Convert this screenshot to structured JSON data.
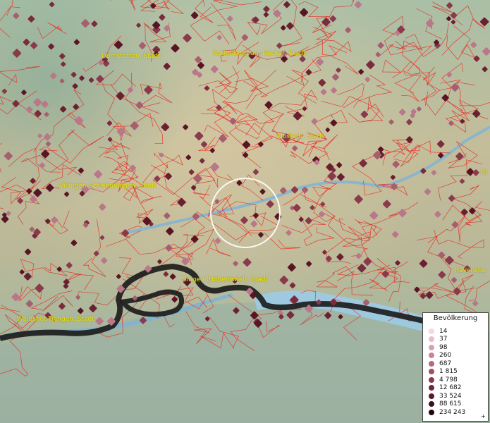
{
  "map": {
    "places": [
      {
        "name": "Dornstetten, Stadt"
      },
      {
        "name": "Rottenburg am Neckar, Stadt"
      },
      {
        "name": "Albstadt, Stadt"
      },
      {
        "name": "Villingen-Schwenningen, Stadt"
      },
      {
        "name": "Singen (Hohentwiel), Stadt"
      },
      {
        "name": "Waldshut-Tiengen, Stadt"
      },
      {
        "name": "Ravensbu"
      },
      {
        "name": "Bi"
      }
    ],
    "colors": {
      "boundary": "#e8201c",
      "marker": "#8a2a3a",
      "water": "#7ab4d8",
      "label": "#e8e000",
      "border_line": "#1a1a1a"
    }
  },
  "legend": {
    "title": "Bevölkerung",
    "items": [
      {
        "label": "14",
        "color": "#f4d8e4"
      },
      {
        "label": "37",
        "color": "#e8bccd"
      },
      {
        "label": "98",
        "color": "#d9a0b2"
      },
      {
        "label": "260",
        "color": "#c98597"
      },
      {
        "label": "687",
        "color": "#b46b7c"
      },
      {
        "label": "1 815",
        "color": "#9c5062"
      },
      {
        "label": "4 798",
        "color": "#863a4b"
      },
      {
        "label": "12 682",
        "color": "#6f2837"
      },
      {
        "label": "33 524",
        "color": "#571a27"
      },
      {
        "label": "88 615",
        "color": "#3c0f1a"
      },
      {
        "label": "234 243",
        "color": "#1c060b"
      }
    ],
    "plus": "+"
  }
}
